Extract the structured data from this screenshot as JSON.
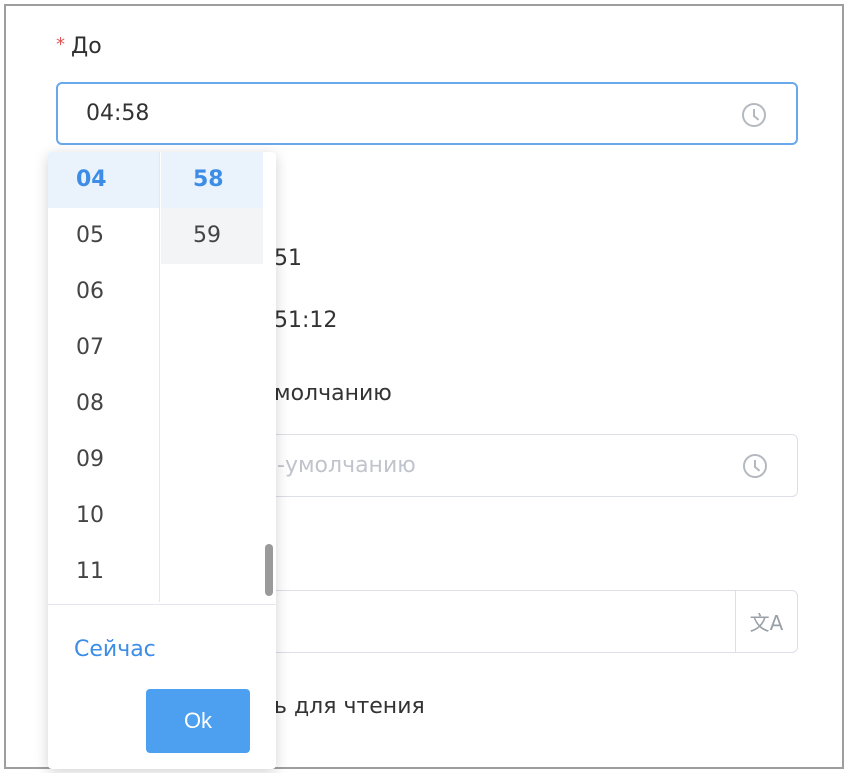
{
  "field_to": {
    "required_mark": "*",
    "label": "До",
    "value": "04:58"
  },
  "background": {
    "text_51": "51",
    "text_51_12": "51:12",
    "label_default": "молчанию",
    "placeholder_default": "-умолчанию",
    "translate_glyph": "文A",
    "readonly_label": "ь для чтения"
  },
  "picker": {
    "hours": [
      "04",
      "05",
      "06",
      "07",
      "08",
      "09",
      "10",
      "11"
    ],
    "minutes": [
      "58",
      "59"
    ],
    "selected_hour": "04",
    "selected_minute": "58",
    "now_label": "Сейчас",
    "ok_label": "Ok"
  },
  "colors": {
    "accent": "#3d8de6",
    "ok_button": "#4da0f0",
    "required": "#e55353",
    "focus_border": "#6aa8ec"
  }
}
